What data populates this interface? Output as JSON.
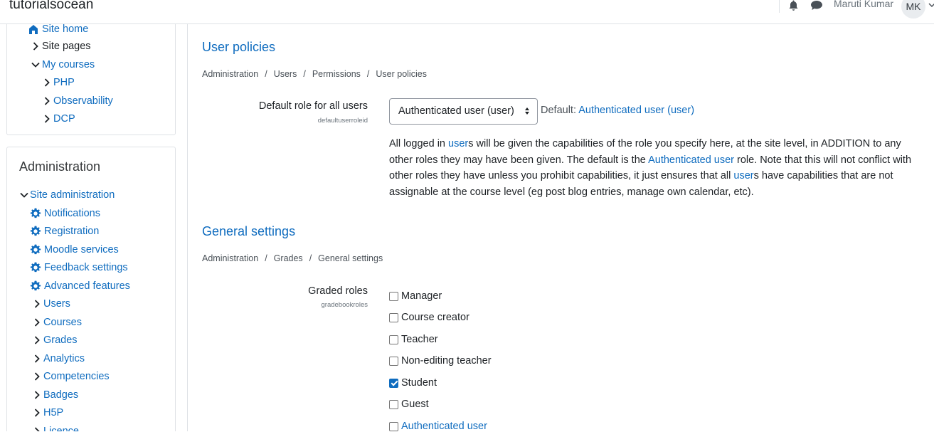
{
  "navbar": {
    "brand": "tutorialsocean",
    "user_name": "Maruti Kumar",
    "avatar_initials": "MK"
  },
  "drawer": {
    "nav_items": [
      {
        "label": "Site home",
        "link": true
      },
      {
        "label": "Site pages",
        "link": false
      },
      {
        "label": "My courses",
        "link": true
      },
      {
        "label": "PHP",
        "link": true
      },
      {
        "label": "Observability",
        "link": true
      },
      {
        "label": "DCP",
        "link": true
      }
    ],
    "admin_title": "Administration",
    "admin_items": [
      {
        "label": "Site administration"
      },
      {
        "label": "Notifications"
      },
      {
        "label": "Registration"
      },
      {
        "label": "Moodle services"
      },
      {
        "label": "Feedback settings"
      },
      {
        "label": "Advanced features"
      },
      {
        "label": "Users"
      },
      {
        "label": "Courses"
      },
      {
        "label": "Grades"
      },
      {
        "label": "Analytics"
      },
      {
        "label": "Competencies"
      },
      {
        "label": "Badges"
      },
      {
        "label": "H5P"
      },
      {
        "label": "Licence"
      }
    ]
  },
  "user_policies": {
    "title": "User policies",
    "breadcrumb": [
      "Administration",
      "Users",
      "Permissions",
      "User policies"
    ],
    "default_role": {
      "label": "Default role for all users",
      "key": "defaultuserroleid",
      "selected": "Authenticated user (user)",
      "default_prefix": "Default: ",
      "default_value": "Authenticated user",
      "default_paren": "(user)",
      "desc": {
        "p1": "All logged in ",
        "l1": "user",
        "p2": "s will be given the capabilities of the role you specify here, at the site level, in ADDITION to any other roles they may have been given. The default is the ",
        "l2": "Authenticated user",
        "p3": " role. Note that this will not conflict with other roles they have unless you prohibit capabilities, it just ensures that all ",
        "l3": "user",
        "p4": "s have capabilities that are not assignable at the course level (eg post blog entries, manage own calendar, etc)."
      }
    }
  },
  "general_settings": {
    "title": "General settings",
    "breadcrumb": [
      "Administration",
      "Grades",
      "General settings"
    ],
    "graded_roles": {
      "label": "Graded roles",
      "key": "gradebookroles",
      "options": [
        {
          "label": "Manager",
          "checked": false,
          "link": false
        },
        {
          "label": "Course creator",
          "checked": false,
          "link": false
        },
        {
          "label": "Teacher",
          "checked": false,
          "link": false
        },
        {
          "label": "Non-editing teacher",
          "checked": false,
          "link": false
        },
        {
          "label": "Student",
          "checked": true,
          "link": false
        },
        {
          "label": "Guest",
          "checked": false,
          "link": false
        },
        {
          "label": "Authenticated user",
          "checked": false,
          "link": true
        }
      ]
    }
  },
  "colors": {
    "link": "#0f6cbf",
    "text": "#1d2125",
    "border": "#dee2e6"
  }
}
